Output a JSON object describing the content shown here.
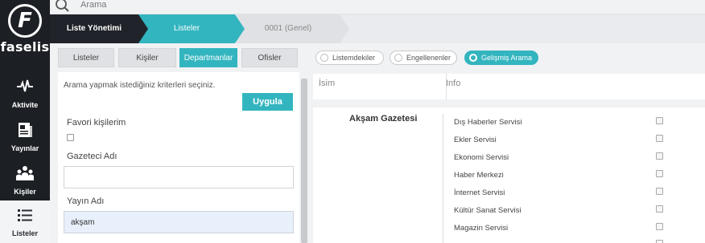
{
  "brand": {
    "logo_letter": "F",
    "name": "faselis"
  },
  "nav": [
    {
      "label": "Aktivite",
      "icon": "activity-icon"
    },
    {
      "label": "Yayınlar",
      "icon": "newspaper-icon"
    },
    {
      "label": "Kişiler",
      "icon": "people-icon"
    },
    {
      "label": "Listeler",
      "icon": "list-icon",
      "active": true
    }
  ],
  "search": {
    "placeholder": "Arama"
  },
  "breadcrumb": [
    "Liste Yönetimi",
    "Listeler",
    "0001 (Genel)"
  ],
  "tabs": [
    "Listeler",
    "Kişiler",
    "Departmanlar",
    "Ofisler"
  ],
  "active_tab": "Departmanlar",
  "form": {
    "hint": "Arama yapmak istediğiniz kriterleri seçiniz.",
    "apply_label": "Uygula",
    "favorites_label": "Favori kişilerim",
    "journalist_label": "Gazeteci Adı",
    "journalist_value": "",
    "publication_label": "Yayın Adı",
    "publication_value": "akşam"
  },
  "filters": [
    "Listemdekiler",
    "Engellenenler",
    "Gelişmiş Arama"
  ],
  "active_filter": "Gelişmiş Arama",
  "table": {
    "columns": [
      "İsim",
      "Info"
    ],
    "rows": [
      {
        "name": "Akşam Gazetesi",
        "departments": [
          "Dış Haberler Servisi",
          "Ekler Servisi",
          "Ekonomi Servisi",
          "Haber Merkezi",
          "İnternet Servisi",
          "Kültür Sanat Servisi",
          "Magazin Servisi"
        ]
      }
    ]
  },
  "colors": {
    "accent": "#33b5bf",
    "sidebar": "#1c1f24",
    "crumb_dark": "#20242a"
  }
}
